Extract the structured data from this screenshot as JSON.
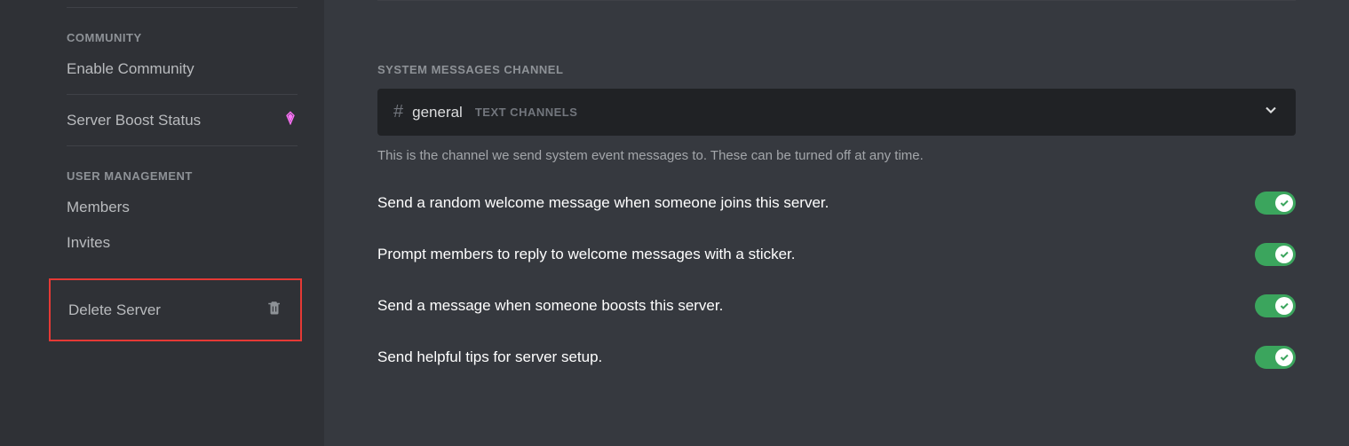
{
  "sidebar": {
    "community_header": "Community",
    "enable_community": "Enable Community",
    "server_boost_status": "Server Boost Status",
    "user_management_header": "User Management",
    "members": "Members",
    "invites": "Invites",
    "delete_server": "Delete Server"
  },
  "main": {
    "section_header": "System Messages Channel",
    "channel_name": "general",
    "channel_category": "Text Channels",
    "description": "This is the channel we send system event messages to. These can be turned off at any time.",
    "toggles": [
      {
        "label": "Send a random welcome message when someone joins this server.",
        "enabled": true
      },
      {
        "label": "Prompt members to reply to welcome messages with a sticker.",
        "enabled": true
      },
      {
        "label": "Send a message when someone boosts this server.",
        "enabled": true
      },
      {
        "label": "Send helpful tips for server setup.",
        "enabled": true
      }
    ]
  }
}
